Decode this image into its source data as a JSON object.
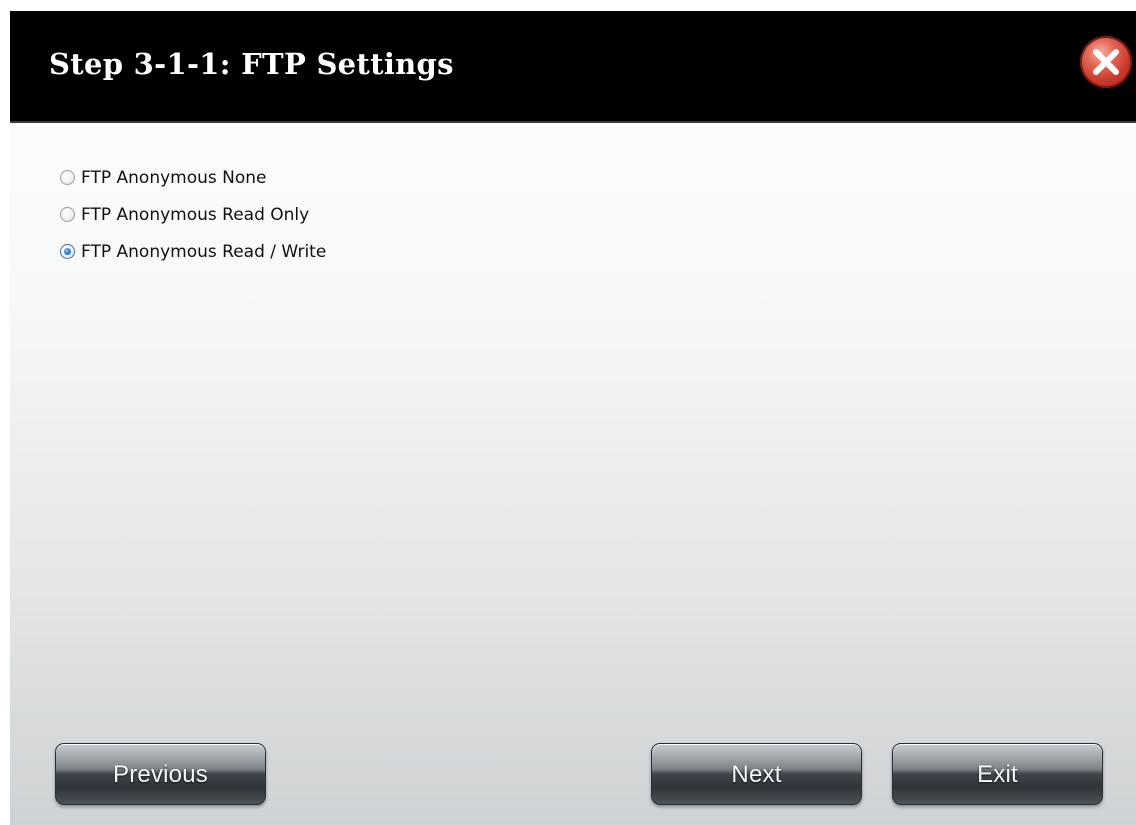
{
  "dialog": {
    "title": "Step 3-1-1: FTP Settings",
    "close_icon": "close-icon"
  },
  "ftp_options": {
    "selected": "FTP Anonymous Read / Write",
    "items": [
      {
        "label": "FTP Anonymous None",
        "checked": false
      },
      {
        "label": "FTP Anonymous Read Only",
        "checked": false
      },
      {
        "label": "FTP Anonymous Read / Write",
        "checked": true
      }
    ]
  },
  "buttons": {
    "previous_label": "Previous",
    "next_label": "Next",
    "exit_label": "Exit"
  },
  "colors": {
    "titlebar": "#000000",
    "close_button": "#c93a2c",
    "radio_selected": "#2f78c4"
  }
}
